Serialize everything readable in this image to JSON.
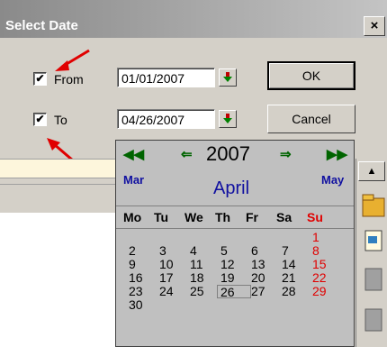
{
  "dialog": {
    "title": "Select Date",
    "close_glyph": "×"
  },
  "from": {
    "checked": true,
    "check_glyph": "✔",
    "label": "From",
    "value": "01/01/2007"
  },
  "to": {
    "checked": true,
    "check_glyph": "✔",
    "label": "To",
    "value": "04/26/2007"
  },
  "buttons": {
    "ok": "OK",
    "cancel": "Cancel"
  },
  "calendar": {
    "prev_year_glyph": "◀◀",
    "prev_month_glyph": "⇐",
    "next_month_glyph": "⇒",
    "next_year_glyph": "▶▶",
    "year": "2007",
    "prev_month": "Mar",
    "month": "April",
    "next_month": "May",
    "weekdays": [
      "Mo",
      "Tu",
      "We",
      "Th",
      "Fr",
      "Sa",
      "Su"
    ],
    "weeks": [
      [
        "",
        "",
        "",
        "",
        "",
        "",
        "1"
      ],
      [
        "2",
        "3",
        "4",
        "5",
        "6",
        "7",
        "8"
      ],
      [
        "9",
        "10",
        "11",
        "12",
        "13",
        "14",
        "15"
      ],
      [
        "16",
        "17",
        "18",
        "19",
        "20",
        "21",
        "22"
      ],
      [
        "23",
        "24",
        "25",
        "26",
        "27",
        "28",
        "29"
      ],
      [
        "30",
        "",
        "",
        "",
        "",
        "",
        ""
      ]
    ],
    "selected_day": "26"
  },
  "colors": {
    "annotation_arrow": "#e00000",
    "sunday": "#e00000",
    "month_text": "#1010a0",
    "nav_arrow": "#006400"
  },
  "icons": {
    "dropdown": "dropdown-arrow-icon",
    "scroll_up": "▲"
  }
}
